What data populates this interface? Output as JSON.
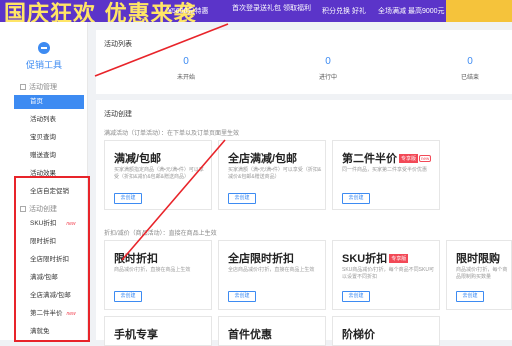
{
  "banner": {
    "headline": "国庆狂欢 优惠来袭",
    "small1": "¥5600元特惠",
    "small2": "首次登录送礼包 领取福利",
    "small3": "积分兑换 好礼",
    "small4": "全场满减 最高9000元"
  },
  "sidebar": {
    "title": "促销工具",
    "group_manage": "活动管理",
    "manage_items": [
      "首页",
      "活动列表",
      "宝贝查询",
      "赠送查询",
      "活动效果",
      "全店自定促销"
    ],
    "group_create": "活动创建",
    "create_items": [
      "SKU折扣",
      "限时折扣",
      "全店限时折扣",
      "满减/包邮",
      "全店满减/包邮",
      "第二件半价",
      "满就免"
    ],
    "new_tag": "new"
  },
  "activity_list": {
    "title": "活动列表",
    "stats": [
      {
        "value": "0",
        "label": "未开始"
      },
      {
        "value": "0",
        "label": "进行中"
      },
      {
        "value": "0",
        "label": "已结束"
      }
    ]
  },
  "activity_create": {
    "title": "活动创建",
    "section1": "满减活动（订单活动）：在下单以及订单页面里生效",
    "section2": "折扣/减价（商品活动）：直接在商品上生效",
    "create_button": "去创建",
    "hot_tag": "专享版",
    "new_tag": "new",
    "cards": [
      {
        "title": "满减/包邮",
        "desc": "买家满额指定商品（满•元/满•件）可以享受（折扣&减价&包邮&赠送商品）"
      },
      {
        "title": "全店满减/包邮",
        "desc": "买家满额（满•元/满•件）可以享受（折扣&减价&包邮&赠送商品）"
      },
      {
        "title": "第二件半价",
        "desc": "同一件商品，买家第二件享受半价优惠"
      },
      {
        "title": "限时折扣",
        "desc": "商品减价/打折，直接在商品上生效"
      },
      {
        "title": "全店限时折扣",
        "desc": "全店商品减价/打折，直接在商品上生效"
      },
      {
        "title": "SKU折扣",
        "desc": "SKU商品减价/打折，每个商品不同SKU可以设置不同折扣"
      },
      {
        "title": "限时限购",
        "desc": "商品减价/打折，每个商品限制购买数量"
      },
      {
        "title": "手机专享",
        "desc": ""
      },
      {
        "title": "首件优惠",
        "desc": ""
      },
      {
        "title": "阶梯价",
        "desc": ""
      }
    ]
  },
  "colors": {
    "accent": "#3d8bf2",
    "highlight": "#e8242a",
    "banner": "#5b34c9"
  }
}
